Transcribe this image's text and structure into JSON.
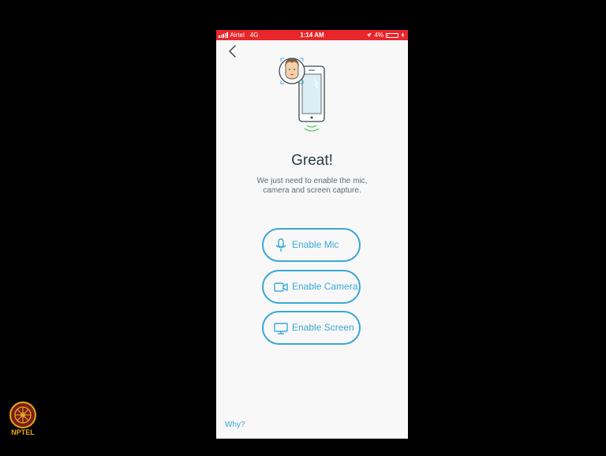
{
  "status_bar": {
    "carrier": "Airtel",
    "network": "4G",
    "time": "1:14 AM",
    "battery": "4%"
  },
  "nav": {
    "back_icon": "chevron-left-icon"
  },
  "content": {
    "heading": "Great!",
    "subtext": "We just need to enable the mic, camera and screen capture."
  },
  "buttons": [
    {
      "label": "Enable Mic",
      "icon": "microphone-icon"
    },
    {
      "label": "Enable Camera",
      "icon": "video-camera-icon"
    },
    {
      "label": "Enable Screen",
      "icon": "monitor-icon"
    }
  ],
  "footer": {
    "why_link": "Why?"
  },
  "watermark": {
    "logo_text": "NPTEL"
  },
  "colors": {
    "status_bar": "#e8262b",
    "accent": "#38a9d6",
    "background": "#f8f8f8",
    "heading": "#2b3b44",
    "body_text": "#5f6b73",
    "signal_green": "#4cc35a",
    "logo_orange": "#e6a817"
  }
}
